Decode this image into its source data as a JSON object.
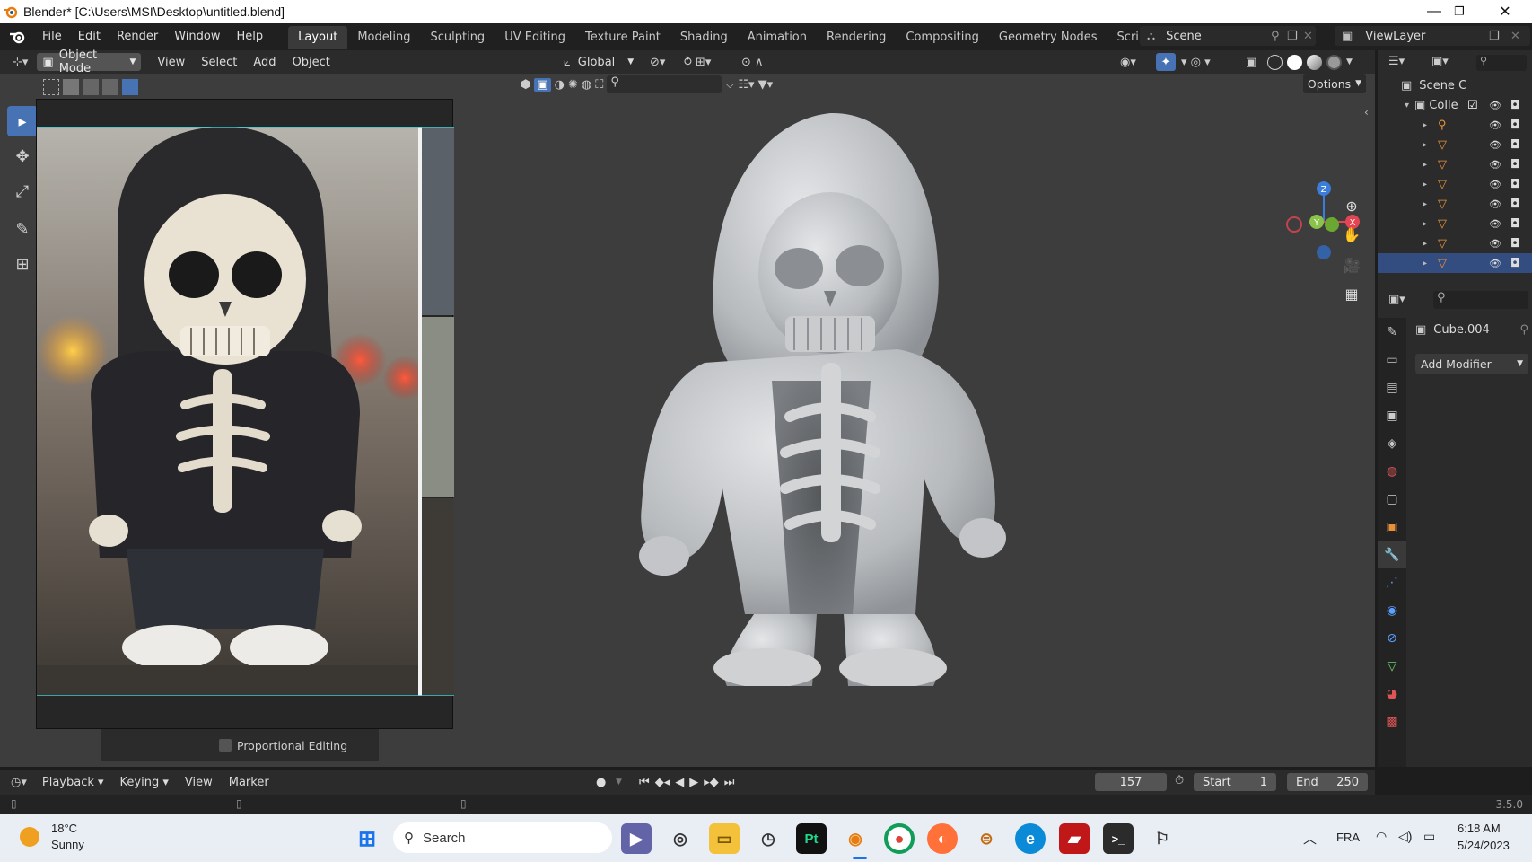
{
  "window": {
    "title": "Blender* [C:\\Users\\MSI\\Desktop\\untitled.blend]"
  },
  "menu": [
    "File",
    "Edit",
    "Render",
    "Window",
    "Help"
  ],
  "workspaces": [
    "Layout",
    "Modeling",
    "Sculpting",
    "UV Editing",
    "Texture Paint",
    "Shading",
    "Animation",
    "Rendering",
    "Compositing",
    "Geometry Nodes",
    "Scripting"
  ],
  "active_workspace": "Layout",
  "scene": "Scene",
  "view_layer": "ViewLayer",
  "viewport_header": {
    "mode": "Object Mode",
    "menus": [
      "View",
      "Select",
      "Add",
      "Object"
    ],
    "transform_orientation": "Global",
    "options_label": "Options"
  },
  "reference_panel": {
    "proportional_editing": "Proportional Editing"
  },
  "outliner": {
    "scene_label": "Scene C",
    "collection_label": "Colle",
    "item_count": 8,
    "selected_index": 7
  },
  "properties": {
    "object_name": "Cube.004",
    "add_modifier": "Add Modifier"
  },
  "timeline": {
    "menus": [
      "Playback",
      "Keying",
      "View",
      "Marker"
    ],
    "current_frame": "157",
    "start_label": "Start",
    "start_value": "1",
    "end_label": "End",
    "end_value": "250"
  },
  "status": {
    "version": "3.5.0"
  },
  "taskbar": {
    "weather_temp": "18°C",
    "weather_desc": "Sunny",
    "search_placeholder": "Search",
    "language": "FRA",
    "time": "6:18 AM",
    "date": "5/24/2023",
    "apps": [
      "windows-start",
      "teams",
      "camera-app",
      "file-explorer",
      "clock-app",
      "pycharm",
      "blender",
      "chrome",
      "firefox",
      "app-extra",
      "edge",
      "app-red",
      "terminal",
      "zbrush"
    ]
  },
  "colors": {
    "accent": "#4772b3",
    "active_tab": "#3a3a3a",
    "viewport_bg": "#3d3d3d",
    "panel_bg": "#2b2b2b",
    "object_orange": "#e8913a"
  }
}
